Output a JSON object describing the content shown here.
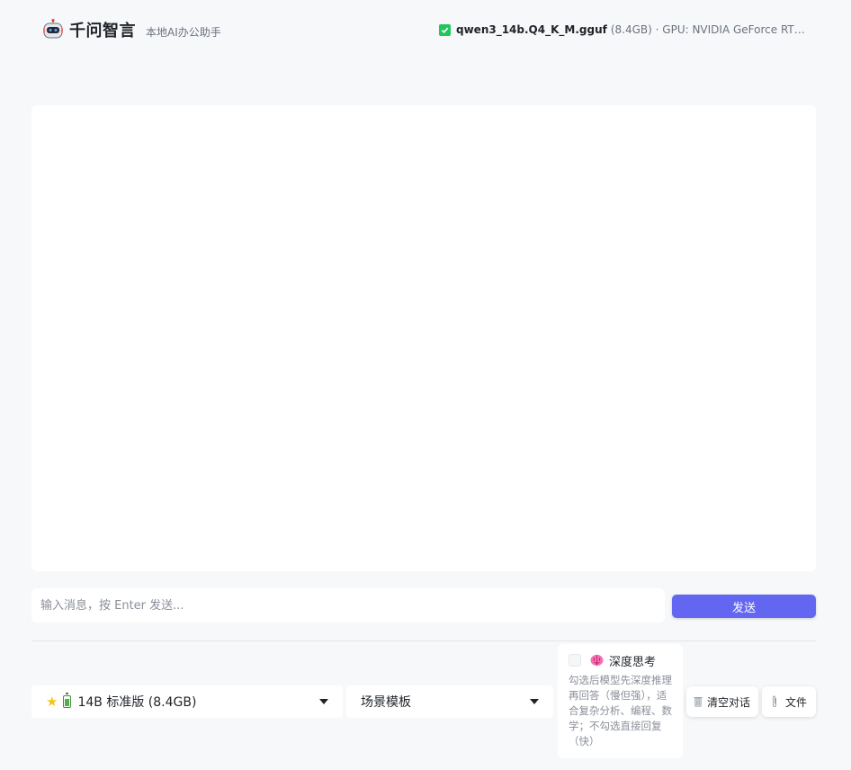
{
  "header": {
    "app_title": "千问智言",
    "app_subtitle": "本地AI办公助手",
    "model_status": {
      "model_name": "qwen3_14b.Q4_K_M.gguf",
      "details": "(8.4GB) · GPU: NVIDIA GeForce RTX ..."
    }
  },
  "input": {
    "placeholder": "输入消息，按 Enter 发送...",
    "send_label": "发送"
  },
  "controls": {
    "model_select": {
      "value": "14B 标准版 (8.4GB)"
    },
    "scene_select": {
      "value": "场景模板"
    },
    "deep_think": {
      "label": "深度思考",
      "checked": false,
      "description": "勾选后模型先深度推理再回答（慢但强），适合复杂分析、编程、数学；不勾选直接回复（快）"
    },
    "clear_label": "清空对话",
    "file_label": "文件"
  },
  "colors": {
    "accent": "#6366f1",
    "success": "#22c55e",
    "background": "#f7f8fa"
  }
}
